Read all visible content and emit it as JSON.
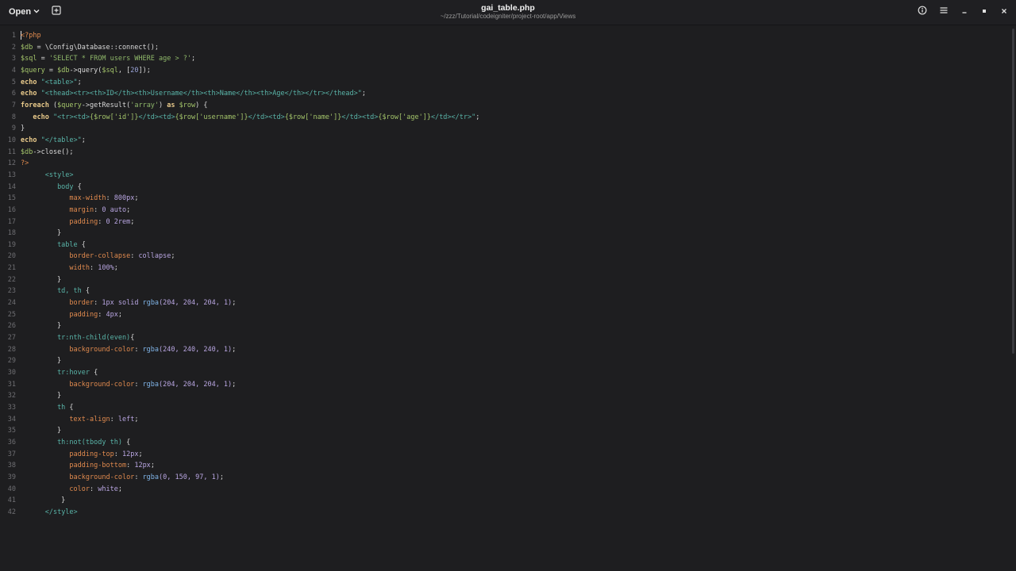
{
  "header": {
    "open_label": "Open",
    "title": "gai_table.php",
    "subtitle": "~/zzz/Tutorial/codeigniter/project-root/app/Views"
  },
  "editor": {
    "lines": [
      {
        "n": "1",
        "segs": [
          {
            "c": "tag",
            "t": "<?php"
          }
        ]
      },
      {
        "n": "2",
        "segs": [
          {
            "c": "v",
            "t": "$db"
          },
          {
            "c": "d",
            "t": " = \\Config\\Database::connect();"
          }
        ]
      },
      {
        "n": "3",
        "segs": [
          {
            "c": "v",
            "t": "$sql"
          },
          {
            "c": "d",
            "t": " = "
          },
          {
            "c": "s",
            "t": "'SELECT * FROM users WHERE age > ?'"
          },
          {
            "c": "d",
            "t": ";"
          }
        ]
      },
      {
        "n": "4",
        "segs": [
          {
            "c": "v",
            "t": "$query"
          },
          {
            "c": "d",
            "t": " = "
          },
          {
            "c": "v",
            "t": "$db"
          },
          {
            "c": "d",
            "t": "->query("
          },
          {
            "c": "v",
            "t": "$sql"
          },
          {
            "c": "d",
            "t": ", ["
          },
          {
            "c": "n",
            "t": "20"
          },
          {
            "c": "d",
            "t": "]);"
          }
        ]
      },
      {
        "n": "5",
        "segs": [
          {
            "c": "kw",
            "t": "echo"
          },
          {
            "c": "d",
            "t": " "
          },
          {
            "c": "st",
            "t": "\"<table>\""
          },
          {
            "c": "d",
            "t": ";"
          }
        ]
      },
      {
        "n": "6",
        "segs": [
          {
            "c": "kw",
            "t": "echo"
          },
          {
            "c": "d",
            "t": " "
          },
          {
            "c": "st",
            "t": "\"<thead><tr><th>ID</th><th>Username</th><th>Name</th><th>Age</th></tr></thead>\""
          },
          {
            "c": "d",
            "t": ";"
          }
        ]
      },
      {
        "n": "7",
        "segs": [
          {
            "c": "kw",
            "t": "foreach"
          },
          {
            "c": "d",
            "t": " ("
          },
          {
            "c": "v",
            "t": "$query"
          },
          {
            "c": "d",
            "t": "->getResult("
          },
          {
            "c": "s",
            "t": "'array'"
          },
          {
            "c": "d",
            "t": ") "
          },
          {
            "c": "kw",
            "t": "as"
          },
          {
            "c": "d",
            "t": " "
          },
          {
            "c": "v",
            "t": "$row"
          },
          {
            "c": "d",
            "t": ") {"
          }
        ]
      },
      {
        "n": "8",
        "segs": [
          {
            "c": "d",
            "t": "   "
          },
          {
            "c": "kw",
            "t": "echo"
          },
          {
            "c": "d",
            "t": " "
          },
          {
            "c": "st",
            "t": "\"<tr><td>"
          },
          {
            "c": "v",
            "t": "{$row['id']}"
          },
          {
            "c": "st",
            "t": "</td><td>"
          },
          {
            "c": "v",
            "t": "{$row['username']}"
          },
          {
            "c": "st",
            "t": "</td><td>"
          },
          {
            "c": "v",
            "t": "{$row['name']}"
          },
          {
            "c": "st",
            "t": "</td><td>"
          },
          {
            "c": "v",
            "t": "{$row['age']}"
          },
          {
            "c": "st",
            "t": "</td></tr>\""
          },
          {
            "c": "d",
            "t": ";"
          }
        ]
      },
      {
        "n": "9",
        "segs": [
          {
            "c": "d",
            "t": "}"
          }
        ]
      },
      {
        "n": "10",
        "segs": [
          {
            "c": "kw",
            "t": "echo"
          },
          {
            "c": "d",
            "t": " "
          },
          {
            "c": "st",
            "t": "\"</table>\""
          },
          {
            "c": "d",
            "t": ";"
          }
        ]
      },
      {
        "n": "11",
        "segs": [
          {
            "c": "v",
            "t": "$db"
          },
          {
            "c": "d",
            "t": "->close();"
          }
        ]
      },
      {
        "n": "12",
        "segs": [
          {
            "c": "tag",
            "t": "?>"
          }
        ]
      },
      {
        "n": "13",
        "segs": [
          {
            "c": "d",
            "t": "      "
          },
          {
            "c": "st",
            "t": "<style>"
          }
        ]
      },
      {
        "n": "14",
        "segs": [
          {
            "c": "d",
            "t": "         "
          },
          {
            "c": "sel",
            "t": "body"
          },
          {
            "c": "d",
            "t": " {"
          }
        ]
      },
      {
        "n": "15",
        "segs": [
          {
            "c": "d",
            "t": "            "
          },
          {
            "c": "p",
            "t": "max-width"
          },
          {
            "c": "d",
            "t": ": "
          },
          {
            "c": "val",
            "t": "800px"
          },
          {
            "c": "d",
            "t": ";"
          }
        ]
      },
      {
        "n": "16",
        "segs": [
          {
            "c": "d",
            "t": "            "
          },
          {
            "c": "p",
            "t": "margin"
          },
          {
            "c": "d",
            "t": ": "
          },
          {
            "c": "val",
            "t": "0 auto"
          },
          {
            "c": "d",
            "t": ";"
          }
        ]
      },
      {
        "n": "17",
        "segs": [
          {
            "c": "d",
            "t": "            "
          },
          {
            "c": "p",
            "t": "padding"
          },
          {
            "c": "d",
            "t": ": "
          },
          {
            "c": "val",
            "t": "0 2rem"
          },
          {
            "c": "d",
            "t": ";"
          }
        ]
      },
      {
        "n": "18",
        "segs": [
          {
            "c": "d",
            "t": "         }"
          }
        ]
      },
      {
        "n": "19",
        "segs": [
          {
            "c": "d",
            "t": "         "
          },
          {
            "c": "sel",
            "t": "table"
          },
          {
            "c": "d",
            "t": " {"
          }
        ]
      },
      {
        "n": "20",
        "segs": [
          {
            "c": "d",
            "t": "            "
          },
          {
            "c": "p",
            "t": "border-collapse"
          },
          {
            "c": "d",
            "t": ": "
          },
          {
            "c": "val",
            "t": "collapse"
          },
          {
            "c": "d",
            "t": ";"
          }
        ]
      },
      {
        "n": "21",
        "segs": [
          {
            "c": "d",
            "t": "            "
          },
          {
            "c": "p",
            "t": "width"
          },
          {
            "c": "d",
            "t": ": "
          },
          {
            "c": "val",
            "t": "100%"
          },
          {
            "c": "d",
            "t": ";"
          }
        ]
      },
      {
        "n": "22",
        "segs": [
          {
            "c": "d",
            "t": "         }"
          }
        ]
      },
      {
        "n": "23",
        "segs": [
          {
            "c": "d",
            "t": "         "
          },
          {
            "c": "sel",
            "t": "td, th"
          },
          {
            "c": "d",
            "t": " {"
          }
        ]
      },
      {
        "n": "24",
        "segs": [
          {
            "c": "d",
            "t": "            "
          },
          {
            "c": "p",
            "t": "border"
          },
          {
            "c": "d",
            "t": ": "
          },
          {
            "c": "val",
            "t": "1px solid "
          },
          {
            "c": "fn",
            "t": "rgba"
          },
          {
            "c": "val",
            "t": "(204, 204, 204, 1)"
          },
          {
            "c": "d",
            "t": ";"
          }
        ]
      },
      {
        "n": "25",
        "segs": [
          {
            "c": "d",
            "t": "            "
          },
          {
            "c": "p",
            "t": "padding"
          },
          {
            "c": "d",
            "t": ": "
          },
          {
            "c": "val",
            "t": "4px"
          },
          {
            "c": "d",
            "t": ";"
          }
        ]
      },
      {
        "n": "26",
        "segs": [
          {
            "c": "d",
            "t": "         }"
          }
        ]
      },
      {
        "n": "27",
        "segs": [
          {
            "c": "d",
            "t": "         "
          },
          {
            "c": "sel",
            "t": "tr:nth-child(even)"
          },
          {
            "c": "d",
            "t": "{"
          }
        ]
      },
      {
        "n": "28",
        "segs": [
          {
            "c": "d",
            "t": "            "
          },
          {
            "c": "p",
            "t": "background-color"
          },
          {
            "c": "d",
            "t": ": "
          },
          {
            "c": "fn",
            "t": "rgba"
          },
          {
            "c": "val",
            "t": "(240, 240, 240, 1)"
          },
          {
            "c": "d",
            "t": ";"
          }
        ]
      },
      {
        "n": "29",
        "segs": [
          {
            "c": "d",
            "t": "         }"
          }
        ]
      },
      {
        "n": "30",
        "segs": [
          {
            "c": "d",
            "t": "         "
          },
          {
            "c": "sel",
            "t": "tr:hover"
          },
          {
            "c": "d",
            "t": " {"
          }
        ]
      },
      {
        "n": "31",
        "segs": [
          {
            "c": "d",
            "t": "            "
          },
          {
            "c": "p",
            "t": "background-color"
          },
          {
            "c": "d",
            "t": ": "
          },
          {
            "c": "fn",
            "t": "rgba"
          },
          {
            "c": "val",
            "t": "(204, 204, 204, 1)"
          },
          {
            "c": "d",
            "t": ";"
          }
        ]
      },
      {
        "n": "32",
        "segs": [
          {
            "c": "d",
            "t": "         }"
          }
        ]
      },
      {
        "n": "33",
        "segs": [
          {
            "c": "d",
            "t": "         "
          },
          {
            "c": "sel",
            "t": "th"
          },
          {
            "c": "d",
            "t": " {"
          }
        ]
      },
      {
        "n": "34",
        "segs": [
          {
            "c": "d",
            "t": "            "
          },
          {
            "c": "p",
            "t": "text-align"
          },
          {
            "c": "d",
            "t": ": "
          },
          {
            "c": "val",
            "t": "left"
          },
          {
            "c": "d",
            "t": ";"
          }
        ]
      },
      {
        "n": "35",
        "segs": [
          {
            "c": "d",
            "t": "         }"
          }
        ]
      },
      {
        "n": "36",
        "segs": [
          {
            "c": "d",
            "t": "         "
          },
          {
            "c": "sel",
            "t": "th:not(tbody th)"
          },
          {
            "c": "d",
            "t": " {"
          }
        ]
      },
      {
        "n": "37",
        "segs": [
          {
            "c": "d",
            "t": "            "
          },
          {
            "c": "p",
            "t": "padding-top"
          },
          {
            "c": "d",
            "t": ": "
          },
          {
            "c": "val",
            "t": "12px"
          },
          {
            "c": "d",
            "t": ";"
          }
        ]
      },
      {
        "n": "38",
        "segs": [
          {
            "c": "d",
            "t": "            "
          },
          {
            "c": "p",
            "t": "padding-bottom"
          },
          {
            "c": "d",
            "t": ": "
          },
          {
            "c": "val",
            "t": "12px"
          },
          {
            "c": "d",
            "t": ";"
          }
        ]
      },
      {
        "n": "39",
        "segs": [
          {
            "c": "d",
            "t": "            "
          },
          {
            "c": "p",
            "t": "background-color"
          },
          {
            "c": "d",
            "t": ": "
          },
          {
            "c": "fn",
            "t": "rgba"
          },
          {
            "c": "val",
            "t": "(0, 150, 97, 1)"
          },
          {
            "c": "d",
            "t": ";"
          }
        ]
      },
      {
        "n": "40",
        "segs": [
          {
            "c": "d",
            "t": "            "
          },
          {
            "c": "p",
            "t": "color"
          },
          {
            "c": "d",
            "t": ": "
          },
          {
            "c": "val",
            "t": "white"
          },
          {
            "c": "d",
            "t": ";"
          }
        ]
      },
      {
        "n": "41",
        "segs": [
          {
            "c": "d",
            "t": "          }"
          }
        ]
      },
      {
        "n": "42",
        "segs": [
          {
            "c": "d",
            "t": "      "
          },
          {
            "c": "st",
            "t": "</style>"
          }
        ]
      }
    ]
  }
}
